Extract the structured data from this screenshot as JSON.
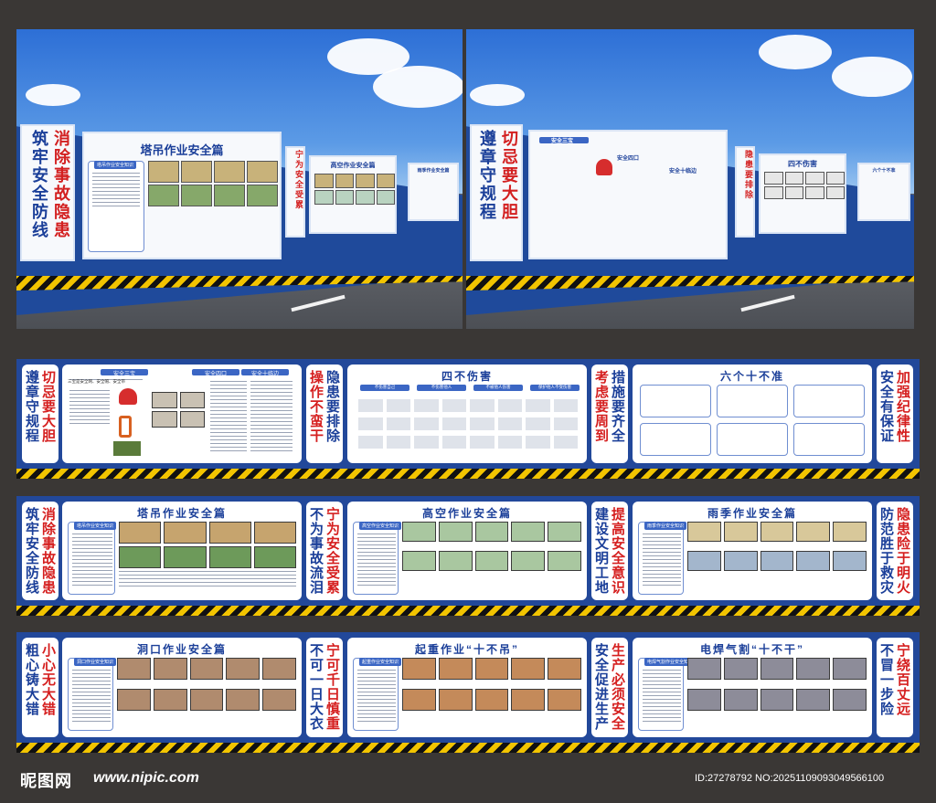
{
  "mockup_left": {
    "slogan_a": "消除事故隐患",
    "slogan_b": "筑牢安全防线",
    "panel_title": "塔吊作业安全篇",
    "box_caption": "塔吊作业安全知识",
    "side_a": "宁为安全受累",
    "side_b": "不为事故流泪",
    "panel2_title": "高空作业安全篇",
    "panel3_title": "雨季作业安全篇"
  },
  "mockup_right": {
    "slogan_a": "切忌要大胆",
    "slogan_b": "遵章守规程",
    "sec1": "安全三宝",
    "sec1_sub": "三宝是安全网、安全帽、安全带",
    "sec2": "安全四口",
    "sec3": "安全十临边",
    "side_a": "隐患要排除",
    "side_b": "操作不蛮干",
    "panel_title": "四不伤害",
    "panel3_title": "六个十不准"
  },
  "row1": {
    "left_a": "切忌要大胆",
    "left_b": "遵章守规程",
    "sec1": "安全三宝",
    "sec1_sub": "三宝是安全网、安全帽、安全带",
    "sec2": "安全四口",
    "sec3": "安全十临边",
    "mid_a": "隐患要排除",
    "mid_b": "操作不蛮干",
    "title2": "四不伤害",
    "tabs": [
      "不伤害自己",
      "不伤害他人",
      "不被他人伤害",
      "保护他人不受伤害"
    ],
    "mid2_a": "措施要齐全",
    "mid2_b": "考虑要周到",
    "title3": "六个十不准",
    "right_a": "加强纪律性",
    "right_b": "安全有保证"
  },
  "row2": {
    "left_a": "消除事故隐患",
    "left_b": "筑牢安全防线",
    "title1": "塔吊作业安全篇",
    "cap1": "塔吊作业安全知识",
    "mid_a": "宁为安全受累",
    "mid_b": "不为事故流泪",
    "title2": "高空作业安全篇",
    "cap2": "高空作业安全知识",
    "mid2_a": "提高安全意识",
    "mid2_b": "建设文明工地",
    "title3": "雨季作业安全篇",
    "cap3": "雨季作业安全知识",
    "right_a": "隐患险于明火",
    "right_b": "防范胜于救灾"
  },
  "row3": {
    "left_a": "小心无大错",
    "left_b": "粗心铸大错",
    "title1": "洞口作业安全篇",
    "cap1": "洞口作业安全知识",
    "mid_a": "宁可千日慎重",
    "mid_b": "不可一日大衣",
    "title2": "起重作业“十不吊”",
    "cap2": "起重作业安全知识",
    "mid2_a": "生产必须安全",
    "mid2_b": "安全促进生产",
    "title3": "电焊气割“十不干”",
    "cap3": "电焊气割作业安全知识",
    "right_a": "宁绕百丈远",
    "right_b": "不冒一步险"
  },
  "footer": {
    "logo": "昵图网",
    "url": "www.nipic.com",
    "id": "ID:27278792 NO:20251109093049566100"
  },
  "colors": {
    "board_blue": "#22489a",
    "slogan_red": "#d51f1f",
    "title_blue": "#1b3f99",
    "hazard_yellow": "#f2c400"
  }
}
